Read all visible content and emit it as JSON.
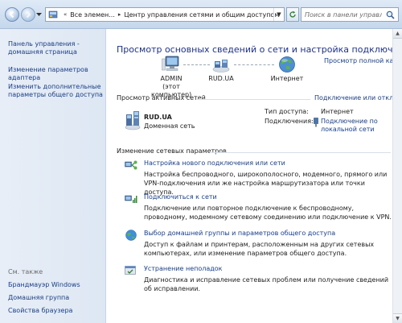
{
  "address_bar": {
    "crumbs": [
      "Все элемен...",
      "Центр управления сетями и общим доступом"
    ],
    "search_placeholder": "Поиск в панели управления"
  },
  "sidebar": {
    "home_link": "Панель управления - домашняя страница",
    "adapter_link": "Изменение параметров адаптера",
    "sharing_link": "Изменить дополнительные параметры общего доступа",
    "see_also_label": "См. также",
    "see_also": [
      "Брандмауэр Windows",
      "Домашняя группа",
      "Свойства браузера"
    ]
  },
  "main": {
    "title": "Просмотр основных сведений о сети и настройка подключений",
    "full_map_link": "Просмотр полной карты",
    "map": {
      "computer_name": "ADMIN",
      "computer_sub": "(этот компьютер)",
      "network_name": "RUD.UA",
      "internet_label": "Интернет"
    },
    "active_networks_header": "Просмотр активных сетей",
    "connect_link": "Подключение или отключение",
    "network": {
      "name": "RUD.UA",
      "type": "Доменная сеть",
      "access_type_label": "Тип доступа:",
      "access_type_value": "Интернет",
      "connections_label": "Подключения:",
      "connections_value": "Подключение по локальной сети"
    },
    "change_settings_header": "Изменение сетевых параметров",
    "tasks": [
      {
        "title": "Настройка нового подключения или сети",
        "desc": "Настройка беспроводного, широкополосного, модемного, прямого или VPN-подключения или же настройка маршрутизатора или точки доступа."
      },
      {
        "title": "Подключиться к сети",
        "desc": "Подключение или повторное подключение к беспроводному, проводному, модемному сетевому соединению или подключение к VPN."
      },
      {
        "title": "Выбор домашней группы и параметров общего доступа",
        "desc": "Доступ к файлам и принтерам, расположенным на других сетевых компьютерах, или изменение параметров общего доступа."
      },
      {
        "title": "Устранение неполадок",
        "desc": "Диагностика и исправление сетевых проблем или получение сведений об исправлении."
      }
    ]
  }
}
